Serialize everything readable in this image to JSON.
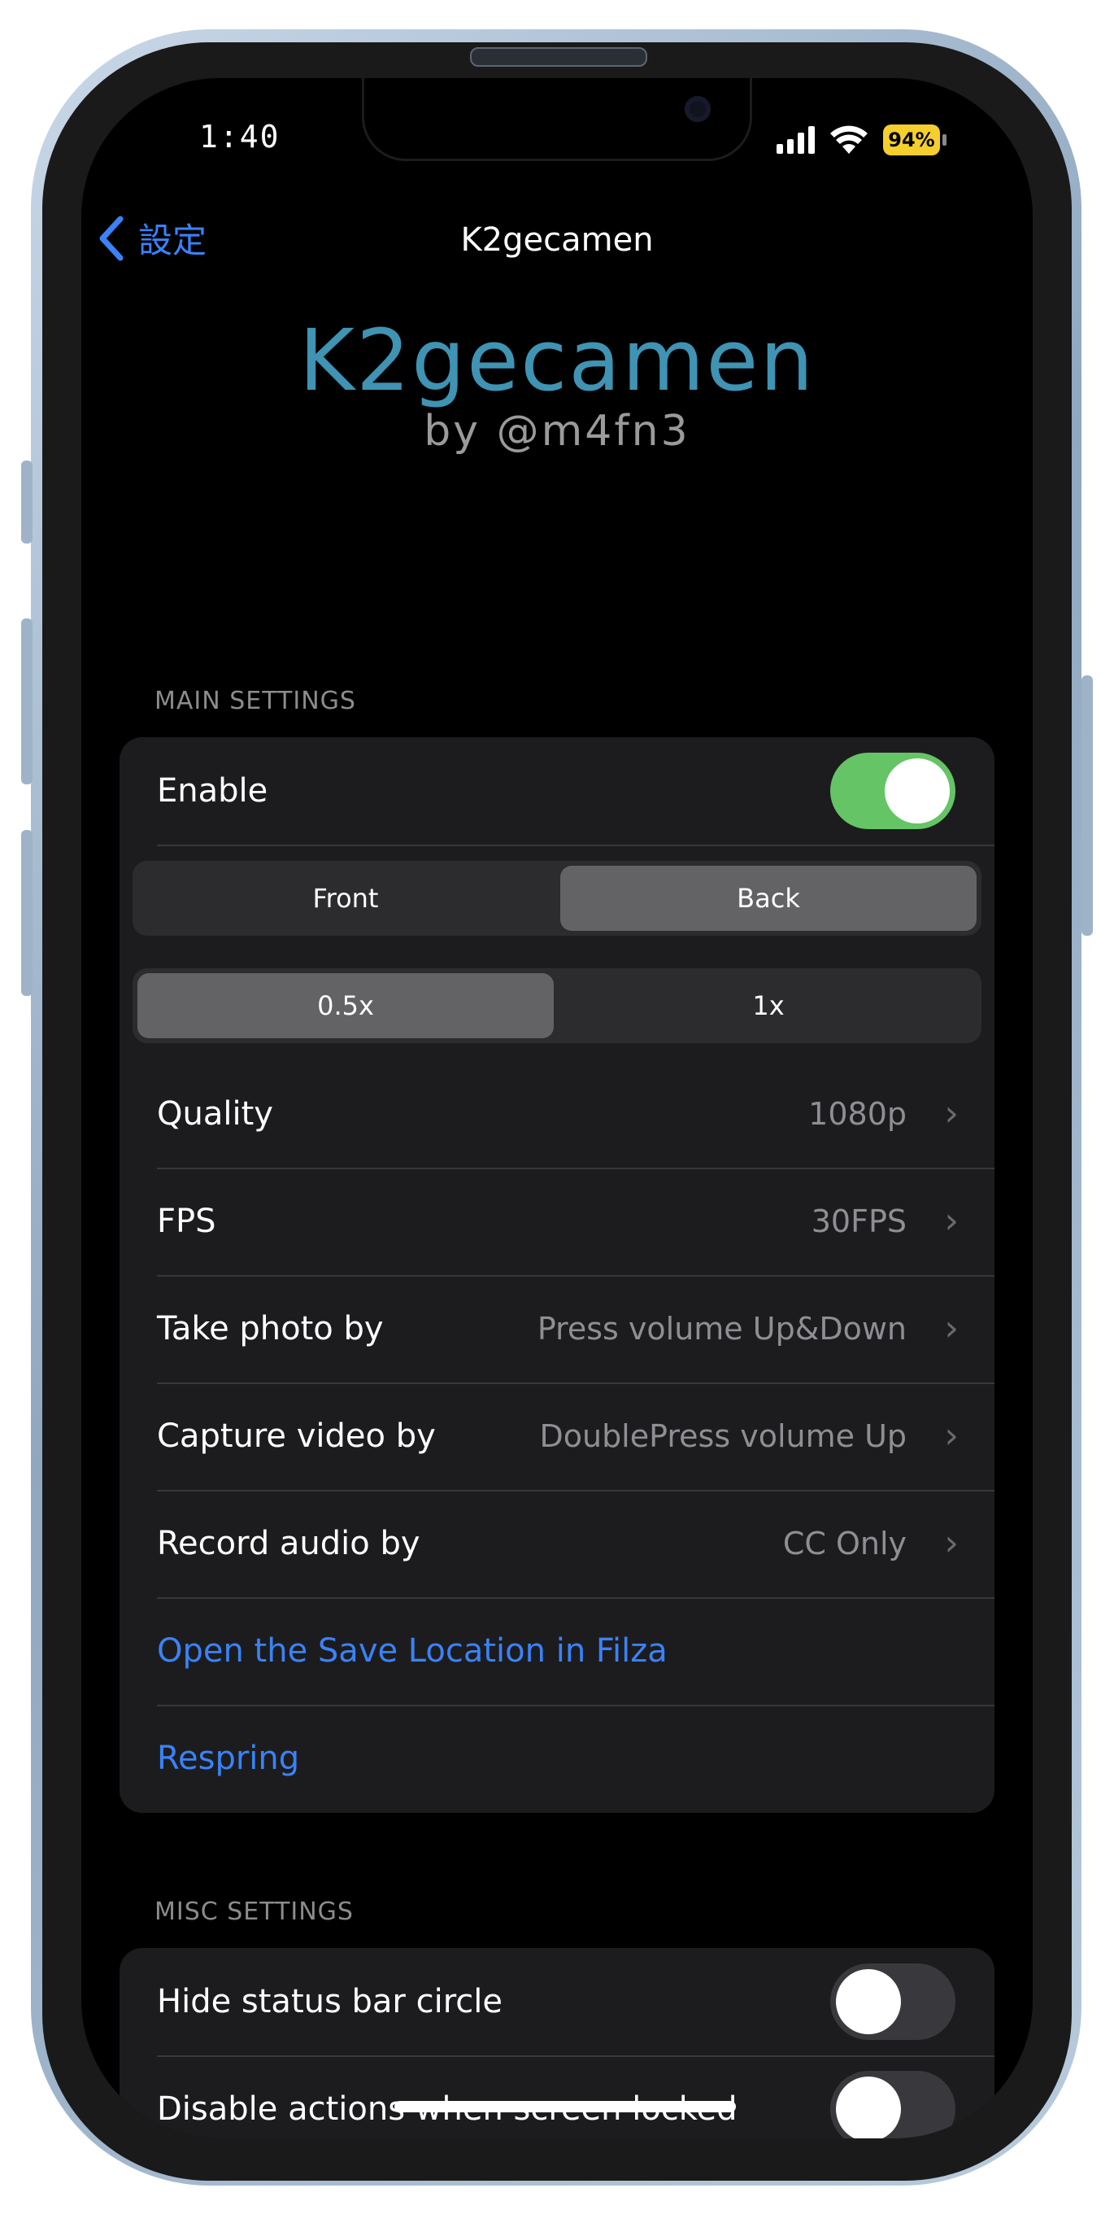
{
  "status_bar": {
    "time": "1:40",
    "battery": "94%",
    "battery_color": "#f5cf2e"
  },
  "nav": {
    "back_label": "設定",
    "title": "K2gecamen",
    "accent": "#3a82f7"
  },
  "hero": {
    "title": "K2gecamen",
    "subtitle": "by @m4fn3",
    "title_color": "#3f93b3"
  },
  "main_settings": {
    "header": "MAIN SETTINGS",
    "enable": {
      "label": "Enable",
      "on": true
    },
    "camera_segment": {
      "options": [
        "Front",
        "Back"
      ],
      "selected": "Back"
    },
    "zoom_segment": {
      "options": [
        "0.5x",
        "1x"
      ],
      "selected": "0.5x"
    },
    "rows": [
      {
        "label": "Quality",
        "value": "1080p"
      },
      {
        "label": "FPS",
        "value": "30FPS"
      },
      {
        "label": "Take photo by",
        "value": "Press volume Up&Down"
      },
      {
        "label": "Capture video by",
        "value": "DoublePress volume Up"
      },
      {
        "label": "Record audio by",
        "value": "CC Only"
      }
    ],
    "links": [
      {
        "label": "Open the Save Location in Filza"
      },
      {
        "label": "Respring"
      }
    ]
  },
  "misc_settings": {
    "header": "MISC SETTINGS",
    "rows": [
      {
        "label": "Hide status bar circle",
        "on": false
      },
      {
        "label": "Disable actions when screen locked",
        "on": false
      }
    ]
  },
  "icons": [
    "back-chevron-icon",
    "chevron-right-icon",
    "cellular-signal-icon",
    "wifi-icon",
    "battery-icon"
  ],
  "colors": {
    "toggle_on": "#65c466",
    "background": "#000000",
    "cell": "#1c1c1e"
  }
}
